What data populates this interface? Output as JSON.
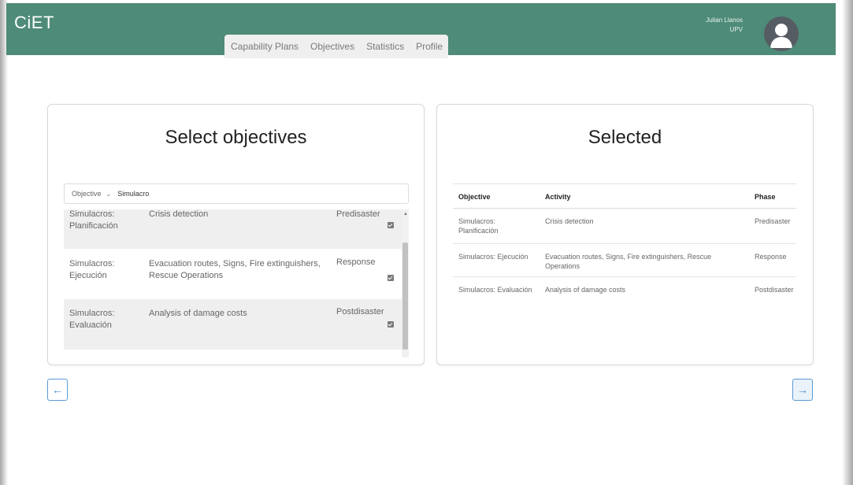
{
  "app": {
    "title": "CiET"
  },
  "nav": {
    "tabs": [
      {
        "label": "Capability Plans"
      },
      {
        "label": "Objectives"
      },
      {
        "label": "Statistics"
      },
      {
        "label": "Profile"
      }
    ]
  },
  "user": {
    "name": "Julian Llanos",
    "org": "UPV"
  },
  "left_panel": {
    "title": "Select objectives",
    "filter_select": "Objective",
    "search_value": "Simulacro",
    "rows": [
      {
        "objective": "Simulacros: Planificación",
        "activity": "Crisis detection",
        "phase": "Predisaster",
        "checked": true
      },
      {
        "objective": "Simulacros: Ejecución",
        "activity": "Evacuation routes, Signs, Fire extinguishers, Rescue Operations",
        "phase": "Response",
        "checked": true
      },
      {
        "objective": "Simulacros: Evaluación",
        "activity": "Analysis of damage costs",
        "phase": "Postdisaster",
        "checked": true
      }
    ]
  },
  "right_panel": {
    "title": "Selected",
    "headers": {
      "objective": "Objective",
      "activity": "Activity",
      "phase": "Phase"
    },
    "rows": [
      {
        "objective": "Simulacros: Planificación",
        "activity": "Crisis detection",
        "phase": "Predisaster"
      },
      {
        "objective": "Simulacros: Ejecución",
        "activity": "Evacuation routes, Signs, Fire extinguishers, Rescue Operations",
        "phase": "Response"
      },
      {
        "objective": "Simulacros: Evaluación",
        "activity": "Analysis of damage costs",
        "phase": "Postdisaster"
      }
    ]
  },
  "buttons": {
    "back_icon": "←",
    "next_icon": "→"
  },
  "colors": {
    "header": "#4e8b78",
    "row_shade": "#efefef",
    "accent": "#4a8fd0"
  }
}
